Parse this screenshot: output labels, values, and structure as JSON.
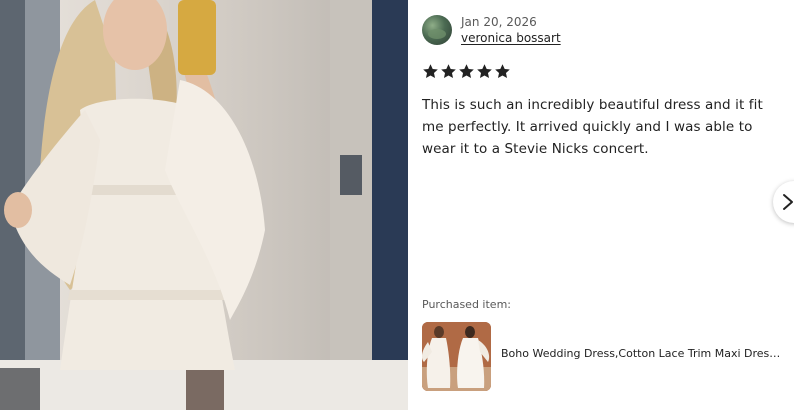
{
  "review": {
    "date": "Jan 20, 2026",
    "reviewer_name": "veronica bossart",
    "rating": 5,
    "text": "This is such an incredibly beautiful dress and it fit me perfectly. It arrived quickly and I was able to wear it to a Stevie Nicks concert."
  },
  "purchased": {
    "label": "Purchased item:",
    "product_name": "Boho Wedding Dress,Cotton Lace Trim Maxi Dress,White Hippie Dress"
  },
  "icons": {
    "star": "star-icon",
    "next": "chevron-right-icon"
  },
  "colors": {
    "star": "#222222",
    "muted_text": "#595959"
  }
}
